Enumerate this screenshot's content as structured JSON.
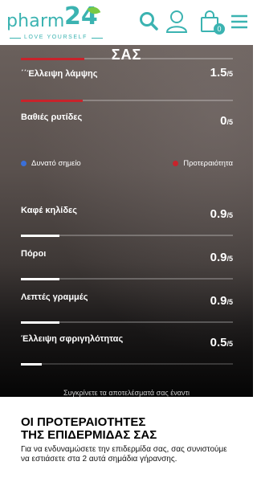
{
  "header": {
    "logo_text": "pharm",
    "logo_number": "24",
    "logo_tagline": "LOVE YOURSELF",
    "cart_count": "0",
    "icons": [
      "search-icon",
      "user-icon",
      "cart-icon",
      "menu-icon"
    ],
    "accent_color": "#3bb3b1"
  },
  "results": {
    "title": "ΣΑΣ",
    "weaknesses": [
      {
        "label": "΄΄Έλλειψη λάμψης",
        "score": "1.5",
        "denominator": "/5",
        "fraction": 0.3
      },
      {
        "label": "Βαθιές ρυτίδες",
        "score": "0",
        "denominator": "/5",
        "fraction": 0.0
      }
    ],
    "legend": {
      "strong_label": "Δυνατό σημείο",
      "strong_color": "#3a6fd8",
      "priority_label": "Προτεραιότητα",
      "priority_color": "#c8232b"
    },
    "strengths": [
      {
        "label": "Καφέ κηλίδες",
        "score": "0.9",
        "denominator": "/5",
        "fraction": 0.18
      },
      {
        "label": "Πόροι",
        "score": "0.9",
        "denominator": "/5",
        "fraction": 0.18
      },
      {
        "label": "Λεπτές γραμμές",
        "score": "0.9",
        "denominator": "/5",
        "fraction": 0.18
      },
      {
        "label": "Έλλειψη σφριγηλότητας",
        "score": "0.5",
        "denominator": "/5",
        "fraction": 0.1
      }
    ],
    "compare_text": "Συγκρίνετε τα αποτελέσματά σας έναντι"
  },
  "priorities": {
    "title_line1": "ΟΙ ΠΡΟΤΕΡΑΙΟΤΗΤΕΣ",
    "title_line2": "ΤΗΣ ΕΠΙΔΕΡΜΙΔΑΣ ΣΑΣ",
    "text_line1": "Για να ενδυναμώσετε την επιδερμίδα σας, σας συνιστούμε",
    "text_line2": "να εστιάσετε στα 2 αυτά σημάδια γήρανσης."
  }
}
